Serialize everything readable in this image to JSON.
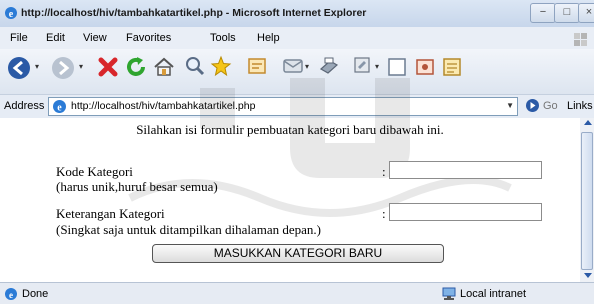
{
  "window": {
    "title": "http://localhost/hiv/tambahkatartikel.php - Microsoft Internet Explorer",
    "minimize": "−",
    "maximize": "□",
    "close": "×"
  },
  "menu": {
    "items": [
      "File",
      "Edit",
      "View",
      "Favorites",
      "Tools",
      "Help"
    ]
  },
  "toolbar": {
    "icons": [
      "back-icon",
      "forward-icon",
      "stop-icon",
      "refresh-icon",
      "home-icon",
      "search-icon",
      "favorites-icon",
      "history-icon",
      "mail-icon",
      "print-icon",
      "edit-icon",
      "discuss-icon",
      "messenger-icon",
      "research-icon"
    ]
  },
  "address": {
    "label": "Address",
    "url": "http://localhost/hiv/tambahkatartikel.php",
    "go": "Go",
    "links": "Links"
  },
  "form": {
    "intro": "Silahkan isi formulir pembuatan kategori baru dibawah ini.",
    "kode_label": "Kode Kategori",
    "kode_hint": "(harus unik,huruf besar semua)",
    "kode_value": "",
    "ket_label": "Keterangan Kategori",
    "ket_hint": "(Singkat saja untuk ditampilkan dihalaman depan.)",
    "ket_value": "",
    "colon": ":",
    "submit": "MASUKKAN KATEGORI BARU"
  },
  "status": {
    "text": "Done",
    "zone": "Local intranet"
  },
  "colors": {
    "accent": "#2b5aa6",
    "stop": "#d8262b",
    "refresh": "#2fa52f"
  }
}
